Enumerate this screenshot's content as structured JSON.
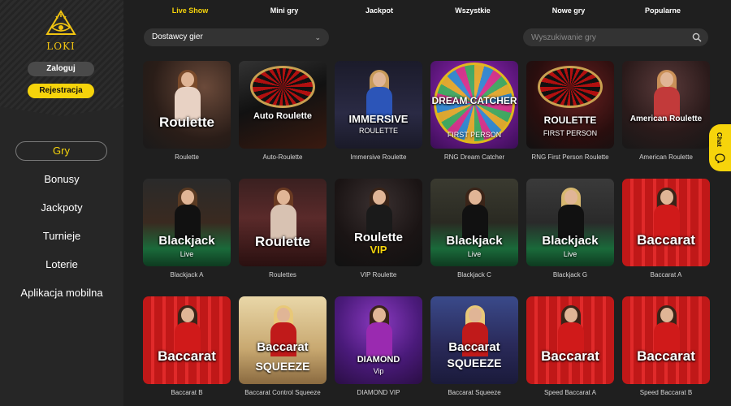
{
  "brand": {
    "logo_text": "LOKI"
  },
  "auth": {
    "login_label": "Zaloguj",
    "register_label": "Rejestracja"
  },
  "nav": {
    "items": [
      {
        "label": "Gry"
      },
      {
        "label": "Bonusy"
      },
      {
        "label": "Jackpoty"
      },
      {
        "label": "Turnieje"
      },
      {
        "label": "Loterie"
      },
      {
        "label": "Aplikacja mobilna"
      }
    ]
  },
  "tabs": [
    {
      "label": "Live Show"
    },
    {
      "label": "Mini gry"
    },
    {
      "label": "Jackpot"
    },
    {
      "label": "Wszystkie"
    },
    {
      "label": "Nowe gry"
    },
    {
      "label": "Popularne"
    }
  ],
  "filters": {
    "provider_label": "Dostawcy gier",
    "search_placeholder": "Wyszukiwanie gry"
  },
  "chat": {
    "label": "Chat"
  },
  "colors": {
    "accent": "#f6d40b",
    "background": "#1f1f1f",
    "sidebar": "#262626"
  },
  "games": [
    {
      "caption": "Roulette",
      "title": "Roulette",
      "subtitle": ""
    },
    {
      "caption": "Auto-Roulette",
      "title": "Auto Roulette",
      "subtitle": ""
    },
    {
      "caption": "Immersive Roulette",
      "title": "IMMERSIVE",
      "subtitle": "ROULETTE"
    },
    {
      "caption": "RNG Dream Catcher",
      "title": "DREAM CATCHER",
      "subtitle": "FIRST PERSON"
    },
    {
      "caption": "RNG First Person Roulette",
      "title": "ROULETTE",
      "subtitle": "FIRST PERSON"
    },
    {
      "caption": "American Roulette",
      "title": "American Roulette",
      "subtitle": ""
    },
    {
      "caption": "Blackjack A",
      "title": "Blackjack",
      "subtitle": "Live"
    },
    {
      "caption": "Roulettes",
      "title": "Roulette",
      "subtitle": ""
    },
    {
      "caption": "VIP Roulette",
      "title": "Roulette",
      "subtitle": "VIP"
    },
    {
      "caption": "Blackjack C",
      "title": "Blackjack",
      "subtitle": "Live"
    },
    {
      "caption": "Blackjack G",
      "title": "Blackjack",
      "subtitle": "Live"
    },
    {
      "caption": "Baccarat A",
      "title": "Baccarat",
      "subtitle": ""
    },
    {
      "caption": "Baccarat B",
      "title": "Baccarat",
      "subtitle": ""
    },
    {
      "caption": "Baccarat Control Squeeze",
      "title": "Baccarat",
      "subtitle": "SQUEEZE"
    },
    {
      "caption": "DIAMOND VIP",
      "title": "DIAMOND",
      "subtitle": "Vip"
    },
    {
      "caption": "Baccarat Squeeze",
      "title": "Baccarat",
      "subtitle": "SQUEEZE"
    },
    {
      "caption": "Speed Baccarat A",
      "title": "Baccarat",
      "subtitle": ""
    },
    {
      "caption": "Speed Baccarat B",
      "title": "Baccarat",
      "subtitle": ""
    }
  ]
}
